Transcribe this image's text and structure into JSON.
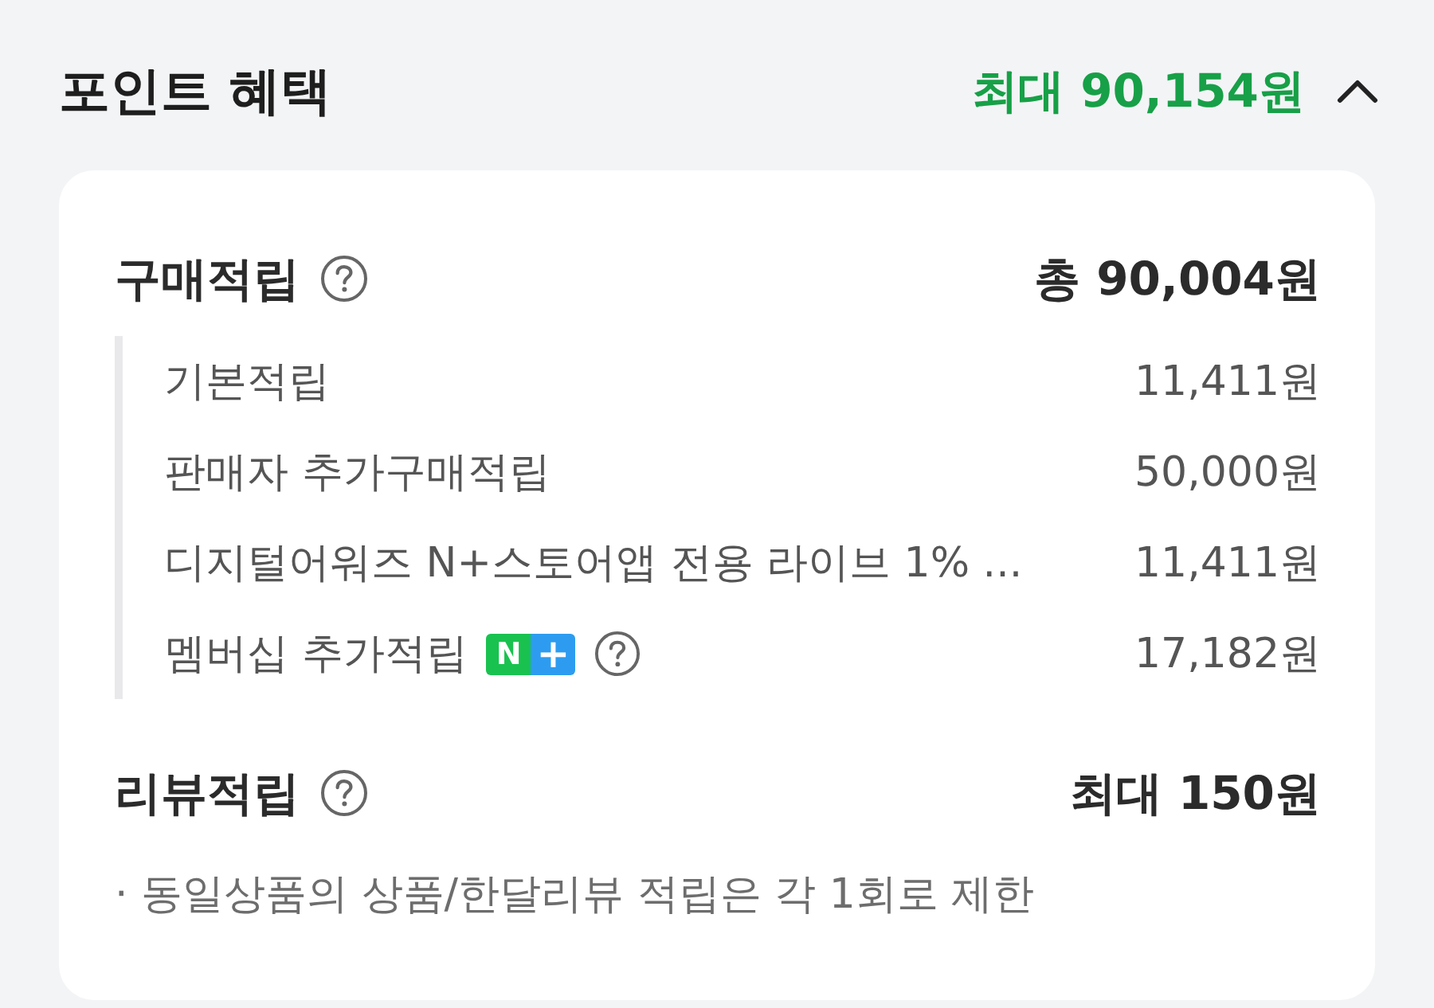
{
  "header": {
    "title": "포인트 혜택",
    "total": "최대 90,154원",
    "expanded": true
  },
  "sections": [
    {
      "title": "구매적립",
      "help": true,
      "amount": "총 90,004원",
      "items": [
        {
          "label": "기본적립",
          "help": false,
          "amount": "11,411원"
        },
        {
          "label": "판매자 추가구매적립",
          "help": false,
          "amount": "50,000원"
        },
        {
          "label": "디지털어워즈 N+스토어앱 전용 라이브 1% ...",
          "help": false,
          "amount": "11,411원"
        },
        {
          "label": "멤버십 추가적립",
          "badge": [
            "N",
            "+"
          ],
          "help": true,
          "amount": "17,182원"
        }
      ]
    },
    {
      "title": "리뷰적립",
      "help": true,
      "amount": "최대 150원",
      "notes": [
        "· 동일상품의 상품/한달리뷰 적립은 각 1회로 제한"
      ]
    }
  ]
}
